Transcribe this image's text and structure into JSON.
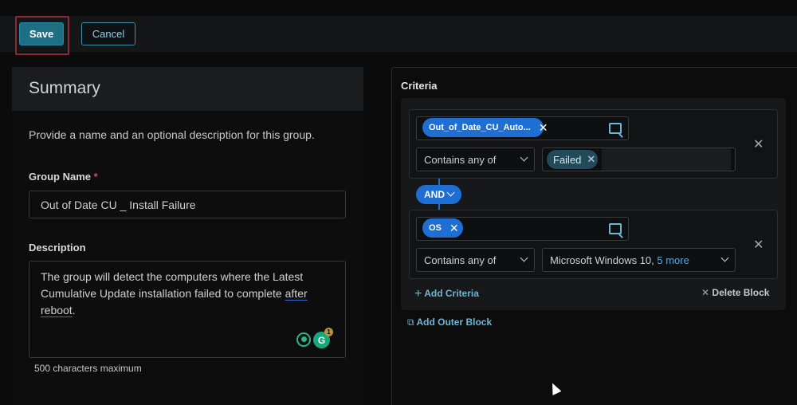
{
  "toolbar": {
    "save_label": "Save",
    "cancel_label": "Cancel"
  },
  "summary": {
    "title": "Summary",
    "description": "Provide a name and an optional description for this group.",
    "group_name_label": "Group Name",
    "required_mark": "*",
    "group_name_value": "Out of Date CU _ Install Failure",
    "description_label": "Description",
    "description_text_a": "The group will detect the computers where the Latest Cumulative Update installation failed to complete ",
    "description_text_b": "after",
    "description_text_c": " reboot.",
    "description_text_b2": "reboot",
    "description_text_c2": ".",
    "char_limit": "500 characters maximum",
    "grammar_badge_count": "1",
    "grammar_icon_letter": "G"
  },
  "criteria": {
    "label": "Criteria",
    "block1": {
      "field_chip": "Out_of_Date_CU_Auto...",
      "operator": "Contains any of",
      "value_chip": "Failed"
    },
    "conjunction": "AND",
    "block2": {
      "field_chip": "OS",
      "operator": "Contains any of",
      "value_text": "Microsoft Windows 10,",
      "value_more": "5 more"
    },
    "add_criteria": "Add Criteria",
    "delete_block": "Delete Block",
    "add_outer_block": "Add Outer Block"
  },
  "colors": {
    "accent": "#1f6ed4",
    "save": "#1e6e84",
    "link": "#6fb6d3",
    "required": "#e0485a"
  },
  "icons": [
    "search-field-icon",
    "close-icon",
    "chevron-down-icon",
    "plus-icon",
    "add-block-icon",
    "grammar-icon"
  ]
}
